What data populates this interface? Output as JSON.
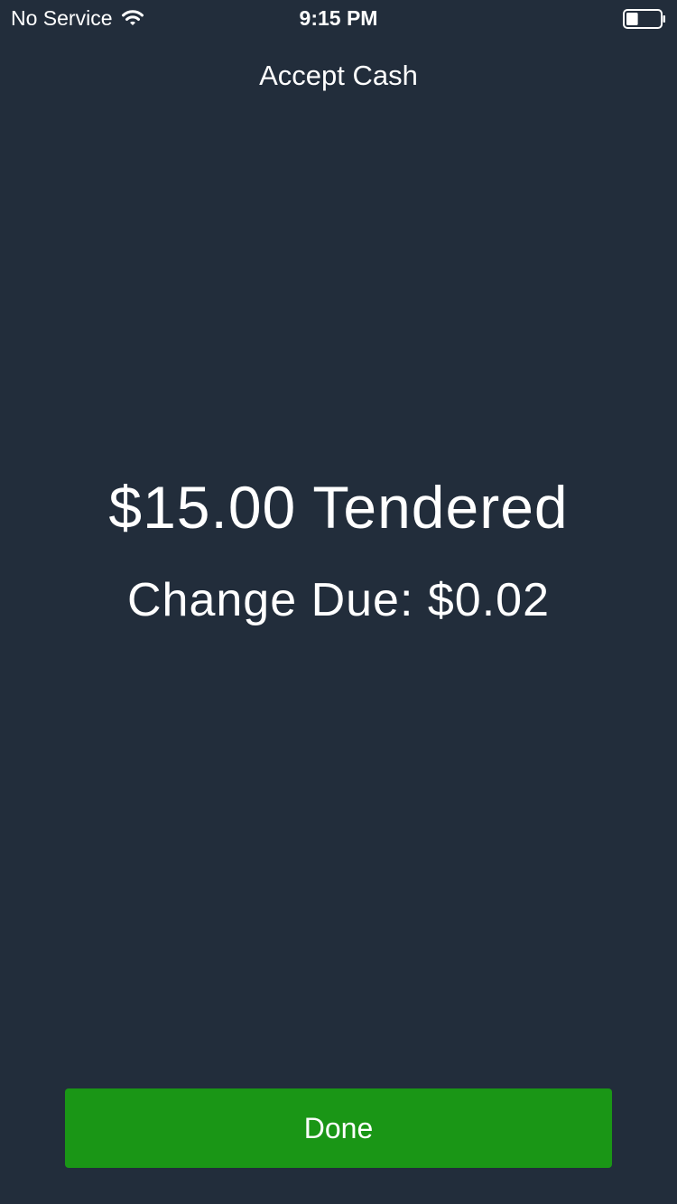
{
  "status_bar": {
    "carrier": "No Service",
    "time": "9:15 PM",
    "icons": [
      "wifi-icon",
      "battery-icon"
    ],
    "battery_level": 0.35
  },
  "header": {
    "title": "Accept Cash"
  },
  "main": {
    "tendered": "$15.00 Tendered",
    "change_due": "Change Due: $0.02"
  },
  "actions": {
    "done_label": "Done"
  },
  "colors": {
    "background": "#222d3b",
    "text": "#ffffff",
    "done_button": "#1a9616"
  }
}
